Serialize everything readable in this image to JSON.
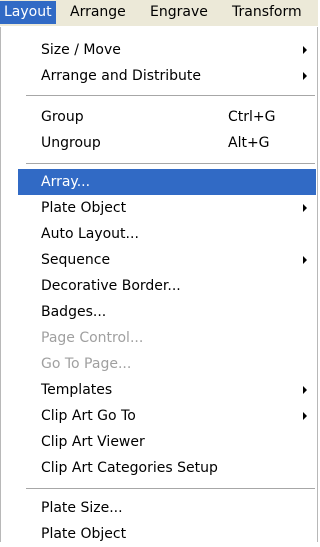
{
  "menubar": {
    "items": [
      {
        "label": "Layout"
      },
      {
        "label": "Arrange"
      },
      {
        "label": "Engrave"
      },
      {
        "label": "Transform"
      }
    ]
  },
  "menu": {
    "items": [
      {
        "label": "Size / Move",
        "submenu": true
      },
      {
        "label": "Arrange and Distribute",
        "submenu": true
      },
      {
        "label": "Group",
        "shortcut": "Ctrl+G"
      },
      {
        "label": "Ungroup",
        "shortcut": "Alt+G"
      },
      {
        "label": "Array...",
        "highlighted": true
      },
      {
        "label": "Plate Object",
        "submenu": true
      },
      {
        "label": "Auto Layout..."
      },
      {
        "label": "Sequence",
        "submenu": true
      },
      {
        "label": "Decorative Border..."
      },
      {
        "label": "Badges..."
      },
      {
        "label": "Page Control...",
        "disabled": true
      },
      {
        "label": "Go To Page...",
        "disabled": true
      },
      {
        "label": "Templates",
        "submenu": true
      },
      {
        "label": "Clip Art Go To",
        "submenu": true
      },
      {
        "label": "Clip Art Viewer"
      },
      {
        "label": "Clip Art Categories Setup"
      },
      {
        "label": "Plate Size..."
      },
      {
        "label": "Plate Object"
      }
    ]
  }
}
